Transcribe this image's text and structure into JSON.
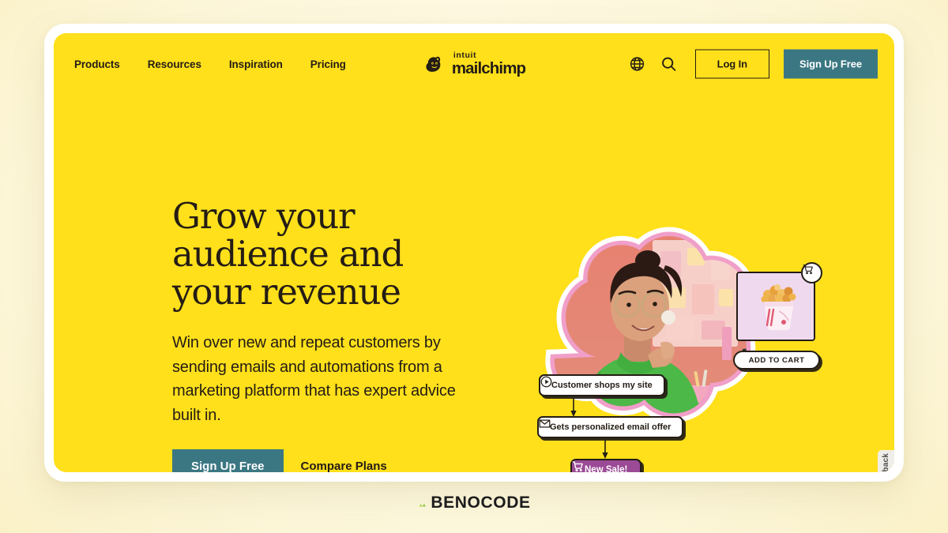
{
  "colors": {
    "brand_yellow": "#ffe01b",
    "ink": "#241c15",
    "teal": "#3b7783",
    "magenta": "#9b4b96",
    "page_bg": "#fdf6dd",
    "accent_lime": "#a8d84a",
    "product_bg": "#efd9ef"
  },
  "nav": {
    "links": [
      {
        "label": "Products"
      },
      {
        "label": "Resources"
      },
      {
        "label": "Inspiration"
      },
      {
        "label": "Pricing"
      }
    ],
    "logo": {
      "icon": "mailchimp-freddie-icon",
      "intuit": "intuit",
      "mailchimp": "mailchimp"
    },
    "globe_icon": "globe-icon",
    "search_icon": "search-icon",
    "login_label": "Log In",
    "signup_label": "Sign Up Free"
  },
  "hero": {
    "title_line1": "Grow your",
    "title_line2": "audience and",
    "title_line3": "your revenue",
    "subtitle": "Win over new and repeat customers by sending emails and automations from a marketing platform that has expert advice built in.",
    "cta_primary": "Sign Up Free",
    "cta_secondary": "Compare Plans"
  },
  "art": {
    "flow_shop": {
      "icon": "cursor-click-icon",
      "label": "Customer shops my site"
    },
    "flow_email": {
      "icon": "envelope-icon",
      "label": "Gets personalized email offer"
    },
    "flow_sale": {
      "icon": "shopping-cart-icon",
      "label": "New Sale!"
    },
    "product": {
      "cart_badge_icon": "shopping-cart-icon",
      "add_to_cart_label": "ADD TO CART"
    }
  },
  "feedback": {
    "label": "Feedback"
  },
  "footer": {
    "brand_mark": "benocode-chevron-icon",
    "brand_name": "BENOCODE"
  }
}
